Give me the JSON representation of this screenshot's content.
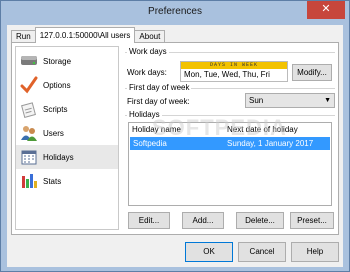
{
  "window": {
    "title": "Preferences",
    "close_glyph": "✕"
  },
  "tabs": [
    {
      "label": "Run"
    },
    {
      "label": "127.0.0.1:50000\\All users"
    },
    {
      "label": "About"
    }
  ],
  "sidebar": {
    "items": [
      {
        "label": "Storage",
        "icon": "storage-icon"
      },
      {
        "label": "Options",
        "icon": "checkmark-icon"
      },
      {
        "label": "Scripts",
        "icon": "scripts-icon"
      },
      {
        "label": "Users",
        "icon": "users-icon"
      },
      {
        "label": "Holidays",
        "icon": "calendar-icon"
      },
      {
        "label": "Stats",
        "icon": "stats-icon"
      }
    ],
    "selected": "Holidays"
  },
  "work_days": {
    "group_title": "Work days",
    "label": "Work days:",
    "banner": "DAYS IN WEEK",
    "value": "Mon, Tue, Wed, Thu, Fri",
    "modify_label": "Modify..."
  },
  "first_day": {
    "group_title": "First day of week",
    "label": "First day of week:",
    "value": "Sun"
  },
  "holidays": {
    "group_title": "Holidays",
    "columns": [
      "Holiday name",
      "Next date of holiday"
    ],
    "rows": [
      {
        "name": "Softpedia",
        "date": "Sunday, 1 January 2017"
      }
    ],
    "buttons": {
      "edit": "Edit...",
      "add": "Add...",
      "delete": "Delete...",
      "preset": "Preset..."
    }
  },
  "watermark": "SOFTPEDIA",
  "footer": {
    "ok": "OK",
    "cancel": "Cancel",
    "help": "Help"
  },
  "colors": {
    "title_bg": "#a9c1de",
    "close": "#c7463c",
    "selection": "#3399ff",
    "banner": "#f2c200"
  }
}
